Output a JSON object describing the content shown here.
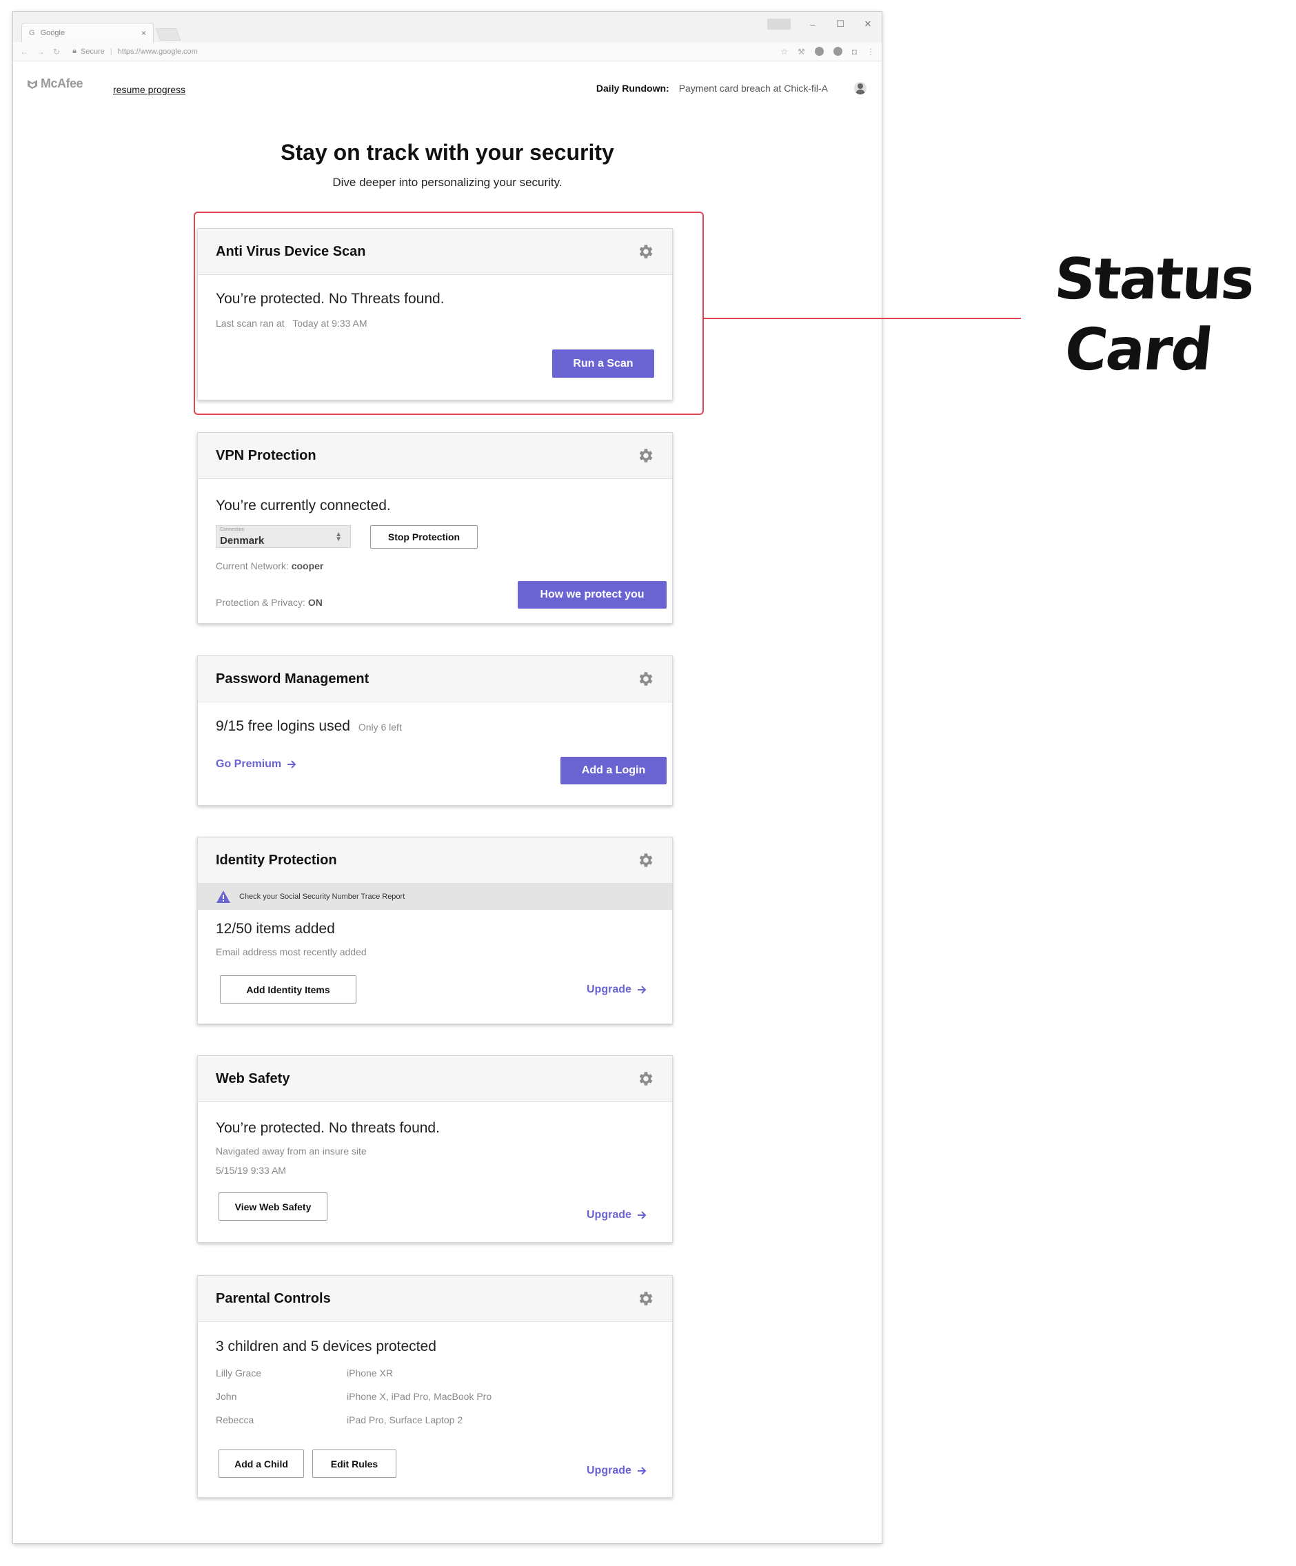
{
  "browser": {
    "tab_title": "Google",
    "tab_icon": "G",
    "secure_label": "Secure",
    "url": "https://www.google.com"
  },
  "header": {
    "logo_text": "McAfee",
    "resume_link": "resume progress",
    "rundown_label": "Daily Rundown:",
    "rundown_text": "Payment card breach at Chick-fil-A"
  },
  "page": {
    "title": "Stay on track with your security",
    "subtitle": "Dive deeper into personalizing your security."
  },
  "cards": {
    "antivirus": {
      "title": "Anti Virus Device Scan",
      "headline": "You’re protected. No Threats found.",
      "last_scan_label": "Last scan ran at",
      "last_scan_value": "Today at 9:33 AM",
      "button": "Run a Scan"
    },
    "vpn": {
      "title": "VPN Protection",
      "headline": "You’re currently connected.",
      "select_label": "Connection",
      "select_value": "Denmark",
      "stop_button": "Stop Protection",
      "network_label": "Current Network:",
      "network_value": "cooper",
      "privacy_label": "Protection & Privacy:",
      "privacy_value": "ON",
      "how_button": "How we protect you"
    },
    "password": {
      "title": "Password Management",
      "headline": "9/15 free logins used",
      "left_note": "Only 6 left",
      "premium_link": "Go Premium",
      "add_button": "Add a Login"
    },
    "identity": {
      "title": "Identity Protection",
      "warning": "Check your Social Security Number Trace Report",
      "headline": "12/50 items added",
      "sub": "Email address most recently added",
      "add_button": "Add Identity Items",
      "upgrade_link": "Upgrade"
    },
    "web": {
      "title": "Web Safety",
      "headline": "You’re protected. No threats found.",
      "sub1": "Navigated away from an insure site",
      "sub2": "5/15/19 9:33 AM",
      "view_button": "View Web Safety",
      "upgrade_link": "Upgrade"
    },
    "parental": {
      "title": "Parental Controls",
      "headline": "3 children and 5 devices protected",
      "children": [
        {
          "name": "Lilly Grace",
          "devices": "iPhone XR"
        },
        {
          "name": "John",
          "devices": "iPhone X, iPad Pro, MacBook Pro"
        },
        {
          "name": "Rebecca",
          "devices": "iPad Pro, Surface Laptop 2"
        }
      ],
      "add_child_button": "Add a Child",
      "edit_rules_button": "Edit Rules",
      "upgrade_link": "Upgrade"
    }
  },
  "annotation": {
    "line1": "Status",
    "line2": "Card"
  },
  "colors": {
    "accent": "#6a64d3",
    "annotation": "#e0454f"
  },
  "icons": [
    "gear-icon",
    "arrow-right-icon",
    "warning-icon",
    "lock-icon",
    "avatar-icon",
    "mcafee-shield-icon"
  ]
}
